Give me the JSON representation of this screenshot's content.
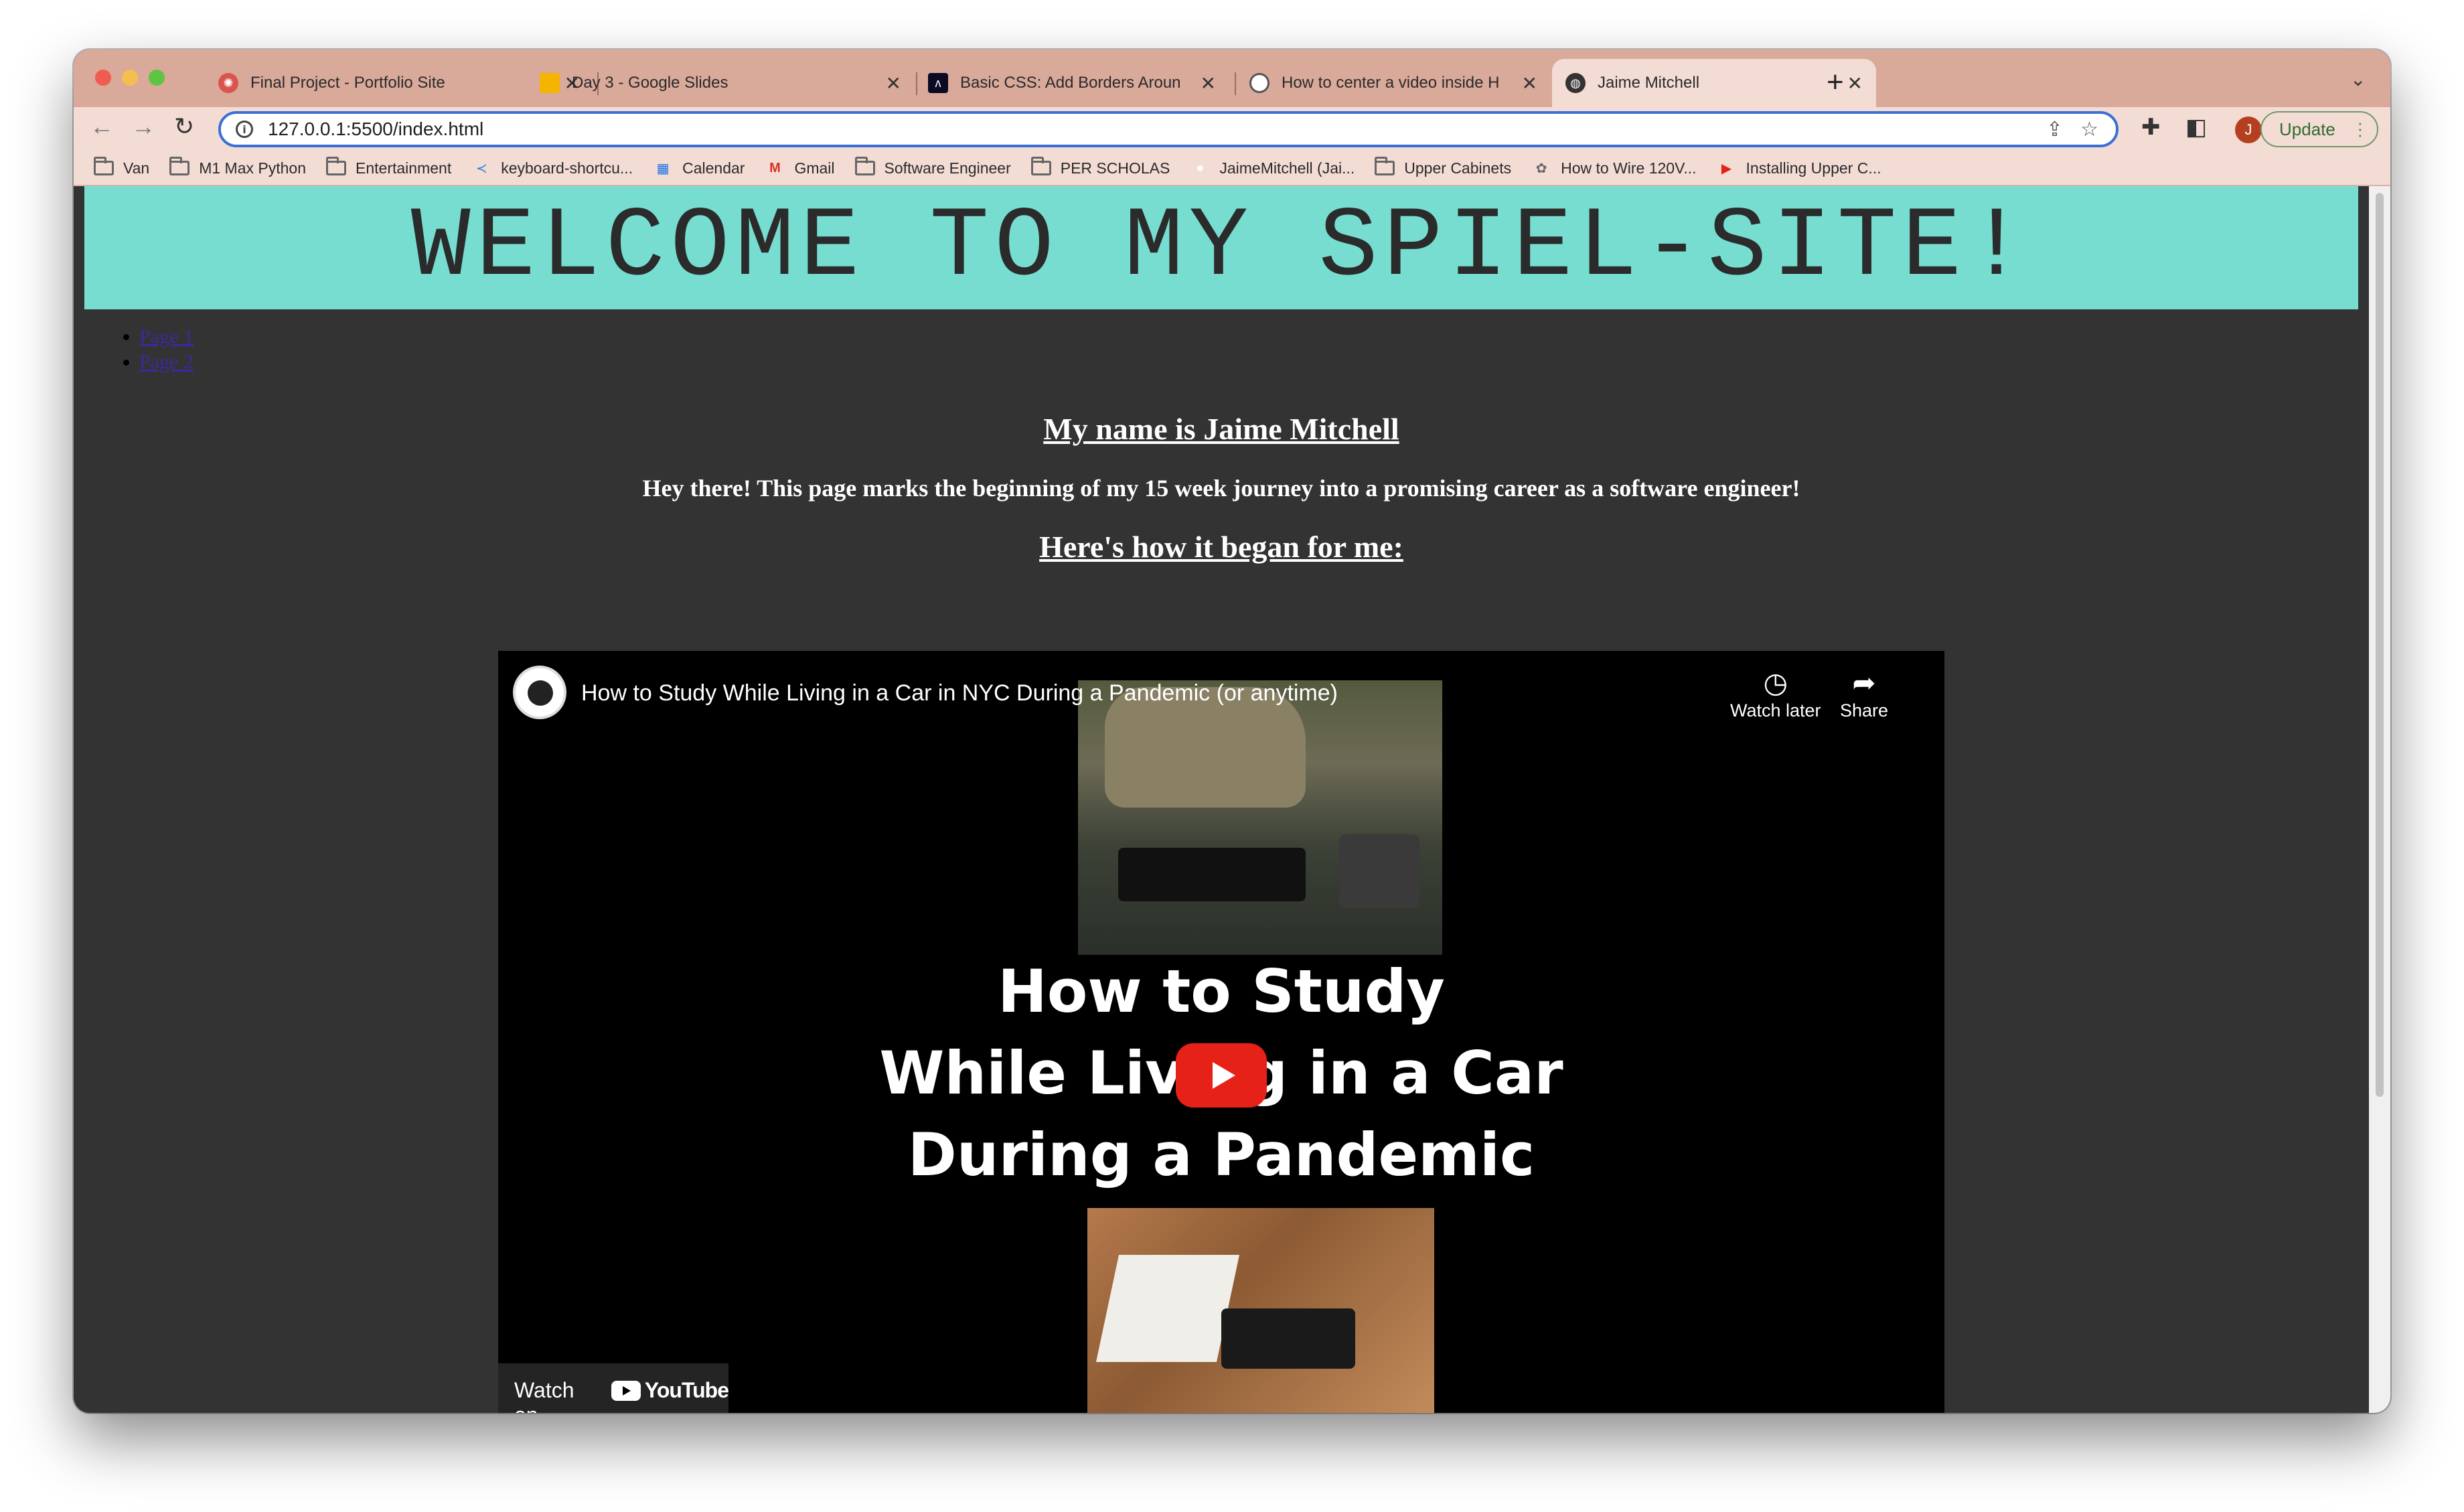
{
  "browser": {
    "tabs": [
      {
        "label": "Final Project - Portfolio Site",
        "icon": "slides-icon",
        "color": "#d9534f"
      },
      {
        "label": "Day 3 - Google Slides",
        "icon": "google-slides-icon",
        "color": "#f4b400"
      },
      {
        "label": "Basic CSS: Add Borders Aroun",
        "icon": "freecodecamp-icon",
        "color": "#0a0a23"
      },
      {
        "label": "How to center a video inside H",
        "icon": "stackoverflow-icon",
        "color": "#555555"
      },
      {
        "label": "Jaime Mitchell",
        "icon": "globe-icon",
        "color": "#333333",
        "active": true
      }
    ],
    "new_tab_label": "+",
    "url": "127.0.0.1:5500/index.html",
    "profile_initial": "J",
    "update_label": "Update",
    "bookmarks": [
      {
        "label": "Van",
        "icon": "folder-icon"
      },
      {
        "label": "M1 Max Python",
        "icon": "folder-icon"
      },
      {
        "label": "Entertainment",
        "icon": "folder-icon"
      },
      {
        "label": "keyboard-shortcu...",
        "icon": "vscode-icon"
      },
      {
        "label": "Calendar",
        "icon": "calendar-icon"
      },
      {
        "label": "Gmail",
        "icon": "gmail-icon"
      },
      {
        "label": "Software Engineer",
        "icon": "folder-icon"
      },
      {
        "label": "PER SCHOLAS",
        "icon": "folder-icon"
      },
      {
        "label": "JaimeMitchell (Jai...",
        "icon": "github-icon"
      },
      {
        "label": "Upper Cabinets",
        "icon": "folder-icon"
      },
      {
        "label": "How to Wire 120V...",
        "icon": "web-icon"
      },
      {
        "label": "Installing Upper C...",
        "icon": "youtube-icon"
      }
    ]
  },
  "page": {
    "banner_title": "WELCOME TO MY SPIEL-SITE!",
    "nav_links": [
      "Page 1",
      "Page 2"
    ],
    "heading_name": "My name is Jaime Mitchell",
    "intro": "Hey there! This page marks the beginning of my 15 week journey into a promising career as a software engineer!",
    "heading_began": "Here's how it began for me:",
    "colors": {
      "banner": "#76ddd0",
      "background": "#333333"
    }
  },
  "video": {
    "title": "How to Study While Living in a Car in NYC During a Pandemic (or anytime)",
    "watch_later_label": "Watch later",
    "share_label": "Share",
    "thumbnail_lines": [
      "How to Study",
      "While Living in a Car",
      "During a Pandemic"
    ],
    "watch_on_label": "Watch on",
    "youtube_label": "YouTube"
  }
}
